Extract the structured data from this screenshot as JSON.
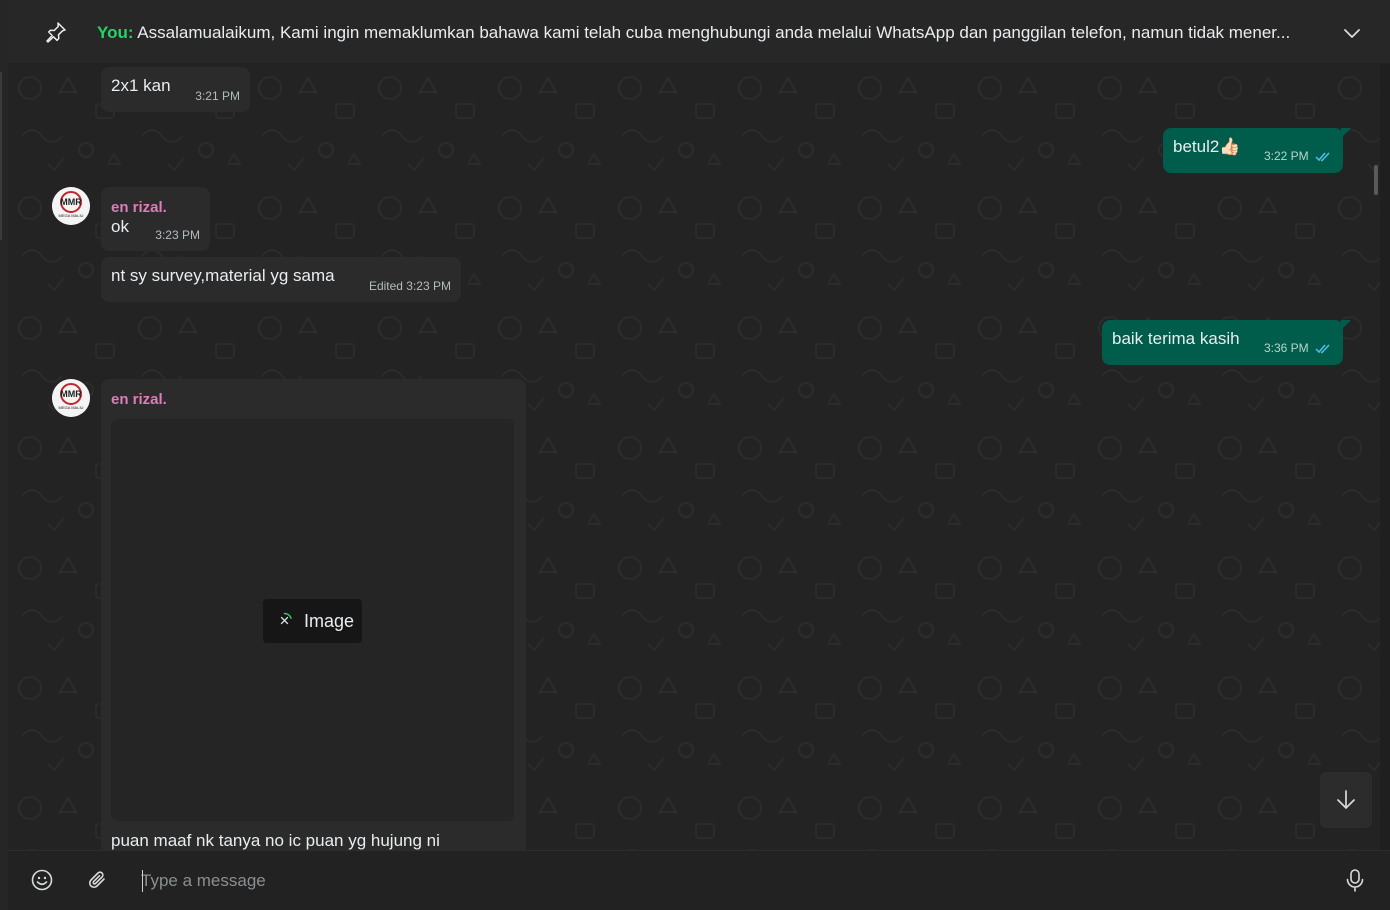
{
  "pinned": {
    "sender_label": "You:",
    "message": " Assalamualaikum,  Kami ingin memaklumkan bahawa kami telah cuba menghubungi anda melalui WhatsApp dan panggilan telefon, namun tidak mener..."
  },
  "messages": [
    {
      "direction": "in",
      "text": "2x1 kan",
      "time": "3:21 PM"
    },
    {
      "direction": "out",
      "text": "betul2👍🏻",
      "time": "3:22 PM"
    },
    {
      "direction": "in",
      "sender": "en rizal.",
      "text": "ok",
      "time": "3:23 PM"
    },
    {
      "direction": "in",
      "text": "nt sy survey,material yg sama",
      "time": "Edited 3:23 PM"
    },
    {
      "direction": "out",
      "text": "baik terima kasih",
      "time": "3:36 PM"
    },
    {
      "direction": "in",
      "sender": "en rizal.",
      "media_label": "Image",
      "caption": "puan maaf nk tanya no ic puan yg hujung ni"
    }
  ],
  "avatar": {
    "text": "MMR",
    "subtext": "MEGA MALIU"
  },
  "composer": {
    "placeholder": "Type a message"
  },
  "colors": {
    "incoming_bubble": "#2b2b2b",
    "outgoing_bubble": "#005c4b",
    "sender_name": "#e07cb6",
    "pinned_sender": "#25d366",
    "read_ticks": "#53bdeb"
  },
  "icons": [
    "pin-icon",
    "chevron-down-icon",
    "emoji-icon",
    "attach-icon",
    "mic-icon",
    "arrow-down-icon",
    "double-check-icon",
    "cancel-download-icon"
  ]
}
